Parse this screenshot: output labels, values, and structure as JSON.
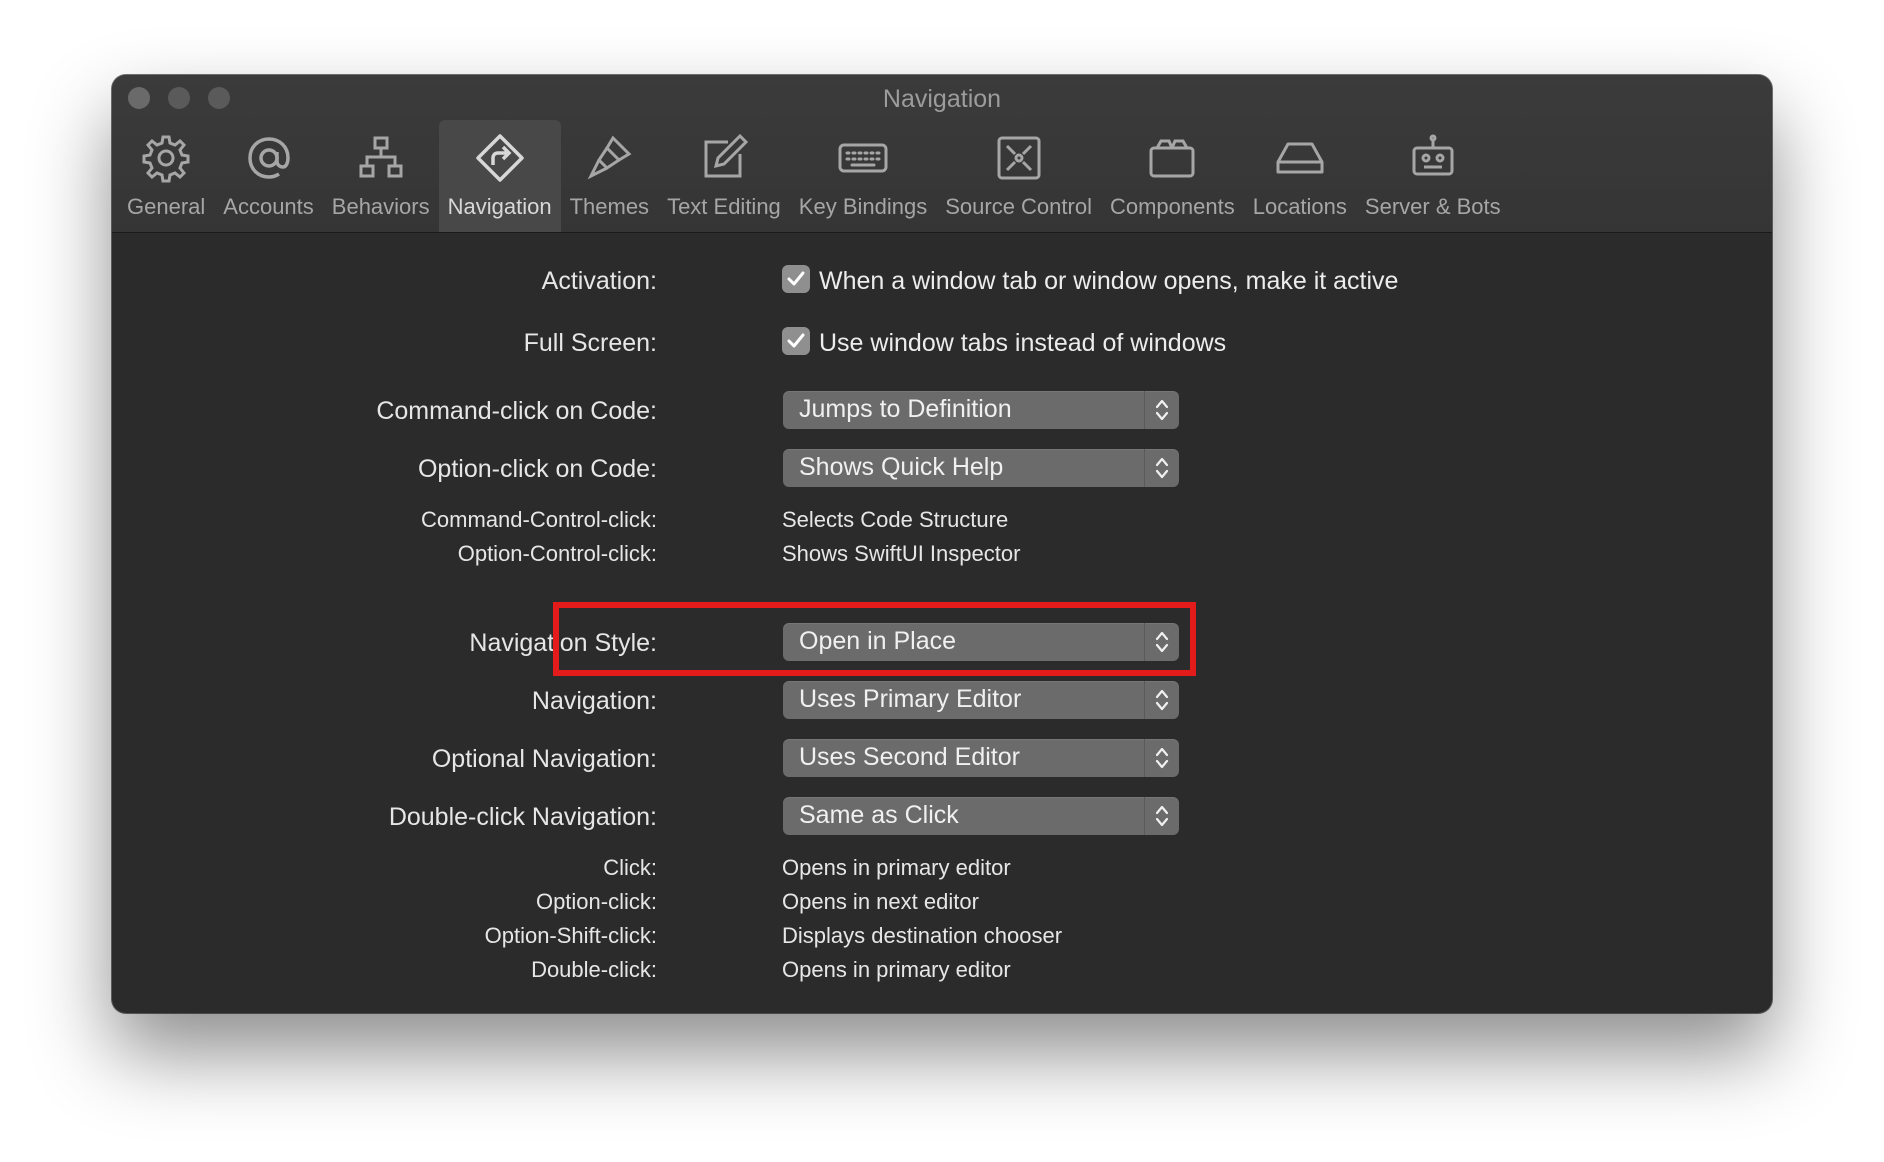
{
  "window": {
    "title": "Navigation"
  },
  "toolbar": {
    "tabs": [
      {
        "label": "General",
        "icon": "gear-icon"
      },
      {
        "label": "Accounts",
        "icon": "at-sign-icon"
      },
      {
        "label": "Behaviors",
        "icon": "hierarchy-icon"
      },
      {
        "label": "Navigation",
        "icon": "navigation-diamond-icon",
        "active": true
      },
      {
        "label": "Themes",
        "icon": "brush-icon"
      },
      {
        "label": "Text Editing",
        "icon": "pencil-square-icon"
      },
      {
        "label": "Key Bindings",
        "icon": "keyboard-icon"
      },
      {
        "label": "Source Control",
        "icon": "source-control-icon"
      },
      {
        "label": "Components",
        "icon": "components-box-icon"
      },
      {
        "label": "Locations",
        "icon": "drive-icon"
      },
      {
        "label": "Server & Bots",
        "icon": "robot-icon"
      }
    ]
  },
  "settings": {
    "activation": {
      "label": "Activation:",
      "checked": true,
      "text": "When a window tab or window opens, make it active"
    },
    "full_screen": {
      "label": "Full Screen:",
      "checked": true,
      "text": "Use window tabs instead of windows"
    },
    "command_click": {
      "label": "Command-click on Code:",
      "value": "Jumps to Definition"
    },
    "option_click_code": {
      "label": "Option-click on Code:",
      "value": "Shows Quick Help"
    },
    "command_control_click": {
      "label": "Command-Control-click:",
      "value": "Selects Code Structure"
    },
    "option_control_click": {
      "label": "Option-Control-click:",
      "value": "Shows SwiftUI Inspector"
    },
    "navigation_style": {
      "label": "Navigation Style:",
      "value": "Open in Place"
    },
    "navigation": {
      "label": "Navigation:",
      "value": "Uses Primary Editor"
    },
    "optional_navigation": {
      "label": "Optional Navigation:",
      "value": "Uses Second Editor"
    },
    "double_click_navigation": {
      "label": "Double-click Navigation:",
      "value": "Same as Click"
    },
    "summary": [
      {
        "label": "Click:",
        "value": "Opens in primary editor"
      },
      {
        "label": "Option-click:",
        "value": "Opens in next editor"
      },
      {
        "label": "Option-Shift-click:",
        "value": "Displays destination chooser"
      },
      {
        "label": "Double-click:",
        "value": "Opens in primary editor"
      }
    ]
  },
  "colors": {
    "highlight": "#e31b1b",
    "window_bg": "#2b2b2b",
    "popup_bg": "#6b6b6b"
  }
}
